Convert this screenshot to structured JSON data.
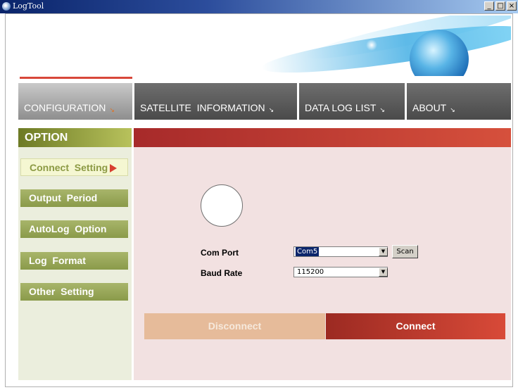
{
  "window": {
    "title": "LogTool",
    "controls": [
      "_",
      "□",
      "×"
    ]
  },
  "nav": {
    "tabs": [
      {
        "label": "CONFIGURATION",
        "active": true
      },
      {
        "label": "SATELLITE  INFORMATION",
        "active": false
      },
      {
        "label": "DATA LOG LIST",
        "active": false
      },
      {
        "label": "ABOUT",
        "active": false
      }
    ],
    "arrow_glyph": "↘"
  },
  "sidebar": {
    "header": "OPTION",
    "items": [
      {
        "label": "Connect  Setting",
        "active": true
      },
      {
        "label": "Output  Period",
        "active": false
      },
      {
        "label": "AutoLog  Option",
        "active": false
      },
      {
        "label": "Log  Format",
        "active": false
      },
      {
        "label": "Other  Setting",
        "active": false
      }
    ]
  },
  "connect": {
    "com_port_label": "Com Port",
    "com_port_value": "Com5",
    "baud_rate_label": "Baud Rate",
    "baud_rate_value": "115200",
    "scan_label": "Scan",
    "disconnect_label": "Disconnect",
    "connect_label": "Connect"
  },
  "colors": {
    "accent_red": "#d84a38",
    "sidebar_green": "#8a9a4a",
    "content_bg": "#f2e1e1"
  }
}
